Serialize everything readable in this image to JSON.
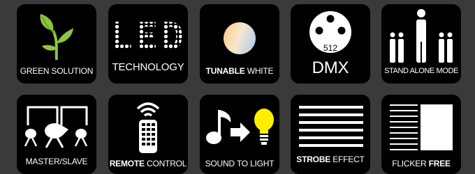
{
  "colors": {
    "background": "#3a3a3a",
    "tile": "#000000",
    "text": "#ffffff",
    "leaf": "#8cc63f",
    "bulb": "#ffee00"
  },
  "tiles": [
    {
      "icon": "leaf-sprout-icon",
      "label_parts": [
        {
          "text": "GREEN SOLUTION",
          "bold": false
        }
      ]
    },
    {
      "icon": "led-dot-matrix-icon",
      "icon_text": "LED",
      "label_parts": [
        {
          "text": "TECHNOLOGY",
          "bold": false
        }
      ]
    },
    {
      "icon": "color-gradient-circle-icon",
      "label_parts": [
        {
          "text": "TUNABLE",
          "bold": true
        },
        {
          "text": " WHITE",
          "bold": false
        }
      ]
    },
    {
      "icon": "dmx-connector-icon",
      "icon_text": "512",
      "label_parts": [
        {
          "text": "DMX",
          "bold": false
        }
      ]
    },
    {
      "icon": "standing-figures-icon",
      "label_parts": [
        {
          "text": "STAND ALONE MODE",
          "bold": false
        }
      ]
    },
    {
      "icon": "linked-spotlights-icon",
      "label_parts": [
        {
          "text": "MASTER/SLAVE",
          "bold": false
        }
      ]
    },
    {
      "icon": "remote-control-icon",
      "label_parts": [
        {
          "text": "REMOTE",
          "bold": true
        },
        {
          "text": " CONTROL",
          "bold": false
        }
      ]
    },
    {
      "icon": "music-to-bulb-icon",
      "label_parts": [
        {
          "text": "SOUND TO LIGHT",
          "bold": false
        }
      ]
    },
    {
      "icon": "strobe-lines-icon",
      "label_parts": [
        {
          "text": "STROBE",
          "bold": true
        },
        {
          "text": " EFFECT",
          "bold": false
        }
      ]
    },
    {
      "icon": "flicker-free-icon",
      "label_parts": [
        {
          "text": "FLICKER",
          "bold": false
        },
        {
          "text": " FREE",
          "bold": true
        }
      ]
    }
  ]
}
